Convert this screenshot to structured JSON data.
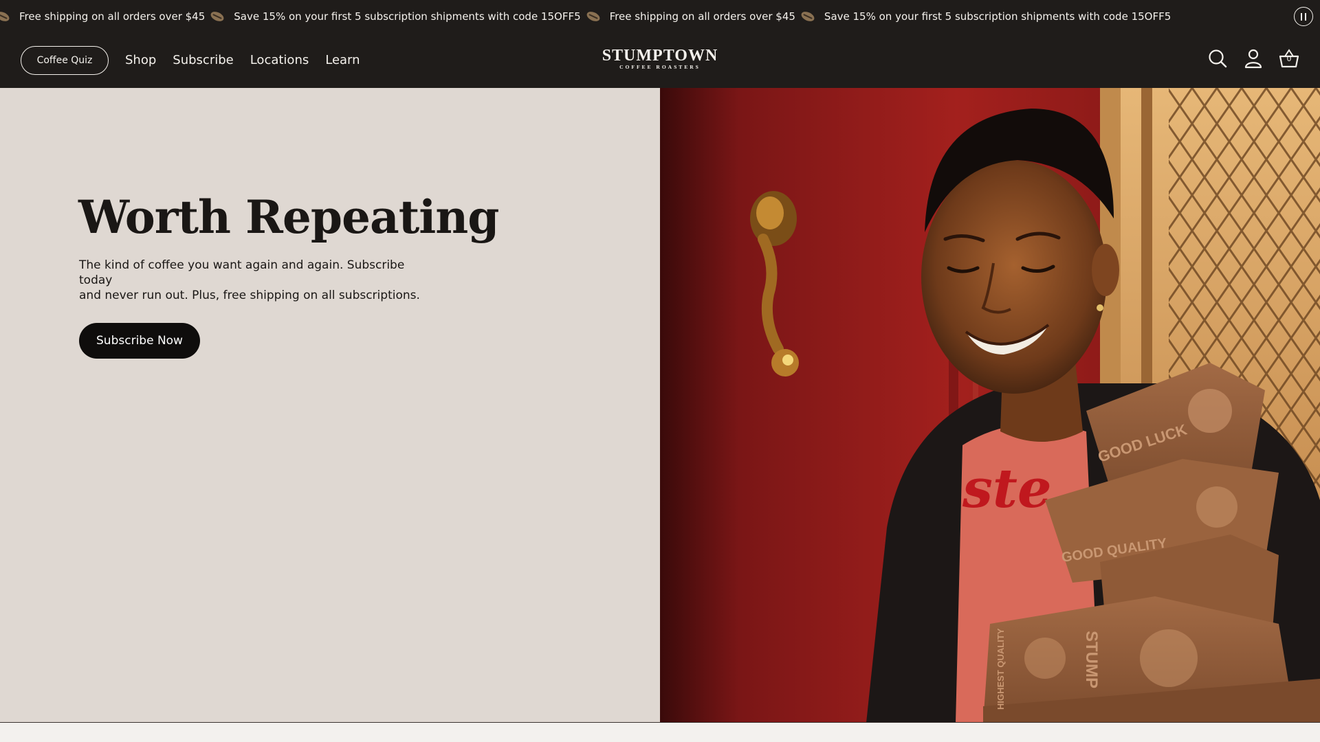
{
  "announcement": {
    "items": [
      "Free shipping on all orders over $45",
      "Save 15% on your first 5 subscription shipments with code 15OFF5",
      "Free shipping on all orders over $45",
      "Save 15% on your first 5 subscription shipments with code 15OFF5"
    ],
    "pause_icon": "pause-icon"
  },
  "header": {
    "quiz_button": "Coffee Quiz",
    "nav": [
      "Shop",
      "Subscribe",
      "Locations",
      "Learn"
    ],
    "logo_main": "STUMPTOWN",
    "logo_sub": "COFFEE ROASTERS",
    "icons": [
      "search-icon",
      "account-icon",
      "cart-icon"
    ],
    "cart_count": "0"
  },
  "hero": {
    "title": "Worth Repeating",
    "subtitle_line1": "The kind of coffee you want again and again. Subscribe today",
    "subtitle_line2": "and never run out. Plus, free shipping on all subscriptions.",
    "cta": "Subscribe Now",
    "image": {
      "box_text_1": "GOOD LUCK",
      "box_text_2": "GOOD QUALITY",
      "box_text_3": "STUMP",
      "box_text_4": "HIGHEST QUALITY",
      "shirt_text": "ste"
    }
  },
  "colors": {
    "header_bg": "#1f1c1a",
    "hero_left_bg": "#dfd8d2",
    "cta_bg": "#0f0d0c",
    "text_light": "#f4f1ec"
  }
}
